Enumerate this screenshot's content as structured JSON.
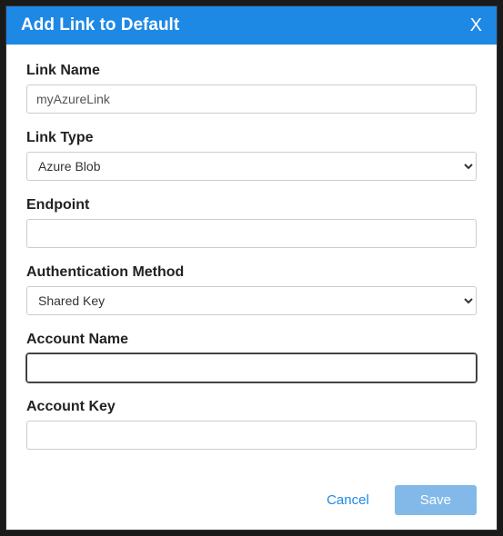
{
  "modal": {
    "title": "Add Link to Default",
    "close": "X"
  },
  "form": {
    "linkName": {
      "label": "Link Name",
      "value": "myAzureLink"
    },
    "linkType": {
      "label": "Link Type",
      "selected": "Azure Blob"
    },
    "endpoint": {
      "label": "Endpoint",
      "value": ""
    },
    "authMethod": {
      "label": "Authentication Method",
      "selected": "Shared Key"
    },
    "accountName": {
      "label": "Account Name",
      "value": ""
    },
    "accountKey": {
      "label": "Account Key",
      "value": ""
    }
  },
  "footer": {
    "cancel": "Cancel",
    "save": "Save"
  }
}
